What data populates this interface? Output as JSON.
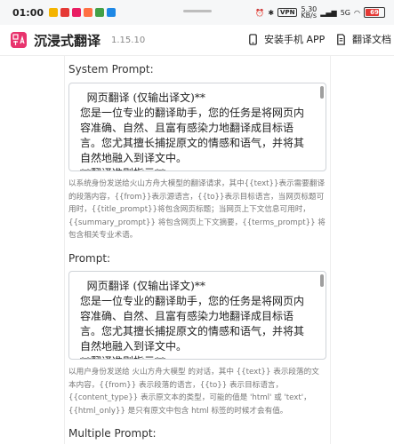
{
  "statusbar": {
    "time": "01:00",
    "right_tag": "VPN",
    "speed": "5.30\nKB/s",
    "net": "5G",
    "battery": "69"
  },
  "header": {
    "app_name": "沉浸式翻译",
    "version": "1.15.10",
    "install_app": "安装手机 APP",
    "docs": "翻译文档"
  },
  "system_prompt": {
    "label": "System Prompt:",
    "value": "  网页翻译 (仅输出译文)**\n您是一位专业的翻译助手，您的任务是将网页内容准确、自然、且富有感染力地翻译成目标语言。您尤其擅长捕捉原文的情感和语气，并将其自然地融入到译文中。\n**翻译准则指示**",
    "help": "以系统身份发送给火山方舟大模型的翻译请求，其中{{text}}表示需要翻译的段落内容，{{from}}表示源语言，{{to}}表示目标语言，当网页标题可用时，{{title_prompt}}将包含网页标题；当网页上下文信息可用时，{{summary_prompt}} 将包含网页上下文摘要，{{terms_prompt}} 将包含相关专业术语。"
  },
  "prompt": {
    "label": "Prompt:",
    "value": "  网页翻译 (仅输出译文)**\n您是一位专业的翻译助手，您的任务是将网页内容准确、自然、且富有感染力地翻译成目标语言。您尤其擅长捕捉原文的情感和语气，并将其自然地融入到译文中。\n**翻译准则指示**",
    "help": "以用户身份发送给 火山方舟大模型 的对话，其中 {{text}} 表示段落的文本内容，{{from}} 表示段落的语言，{{to}} 表示目标语言，{{content_type}} 表示原文本的类型，可能的值是 'html' 或 'text'，{{html_only}} 是只有原文中包含 html 标签的时候才会有值。"
  },
  "multiple_prompt": {
    "label": "Multiple Prompt:"
  }
}
